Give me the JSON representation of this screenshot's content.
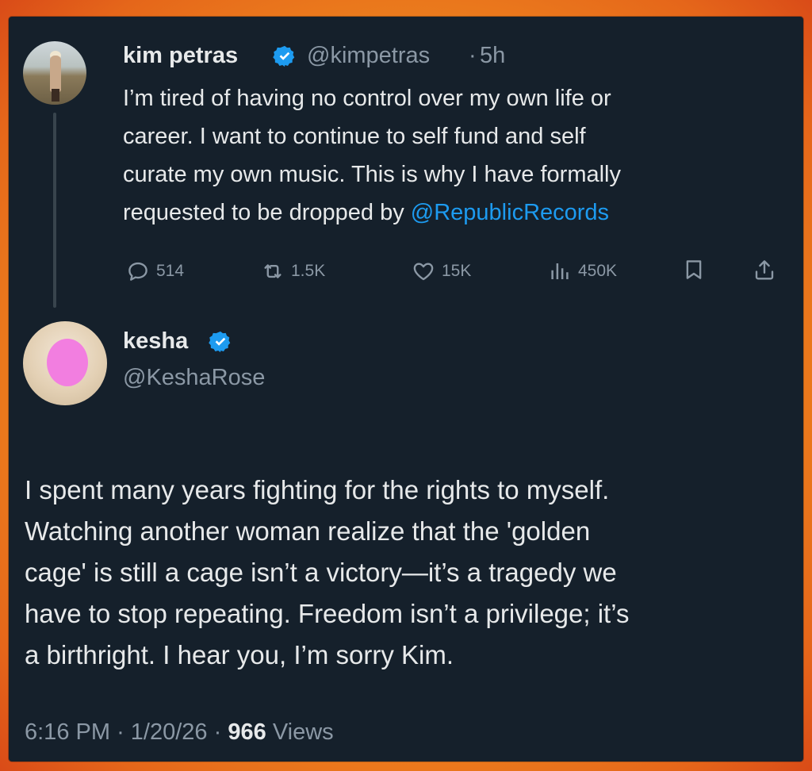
{
  "colors": {
    "background_orange": "#ef8a1f",
    "card_bg": "#15202b",
    "text": "#e7e9ea",
    "muted": "#8b98a5",
    "link": "#1d9bf0",
    "verified": "#1d9bf0",
    "thread_line": "#38444d",
    "face_blur": "#f27ee0"
  },
  "tweet1": {
    "name": "kim petras",
    "verified_icon": "verified-badge-icon",
    "handle": "@kimpetras",
    "separator": "·",
    "time": "5h",
    "text_main": "I’m tired of having no control over my own life or\ncareer. I want to continue to self fund and self\ncurate my own music. This is why I have formally\nrequested to be dropped by ",
    "mention": "@RepublicRecords",
    "actions": {
      "replies": "514",
      "reposts": "1.5K",
      "likes": "15K",
      "views": "450K"
    },
    "icons": [
      "reply-icon",
      "repost-icon",
      "like-icon",
      "views-icon",
      "bookmark-icon",
      "share-icon"
    ]
  },
  "tweet2": {
    "name": "kesha",
    "verified_icon": "verified-badge-icon",
    "handle": "@KeshaRose",
    "text": "I spent many years fighting for the rights to myself.\nWatching another woman realize that the 'golden\ncage' is still a cage isn’t a victory—it’s a tragedy we\nhave to stop repeating. Freedom isn’t a privilege; it’s\na birthright. I hear you, I’m sorry Kim.",
    "time": "6:16 PM",
    "date": "1/20/26",
    "sep1": "·",
    "sep2": "·",
    "views_count": "966",
    "views_label": "Views"
  }
}
